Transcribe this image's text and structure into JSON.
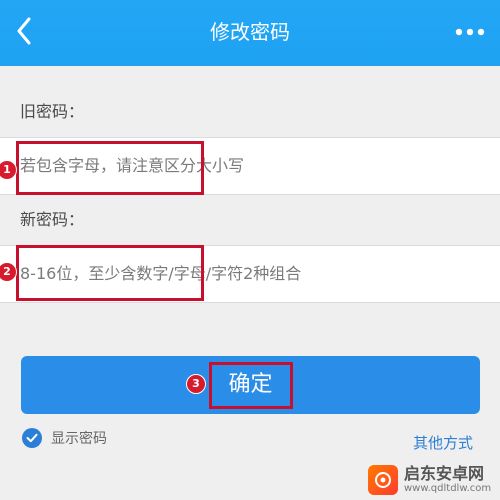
{
  "header": {
    "title": "修改密码",
    "back_icon": "chevron-left-icon",
    "more_icon": "more-dots-icon",
    "color": "#1ea1f2"
  },
  "old_password": {
    "label": "旧密码：",
    "placeholder": "若包含字母，请注意区分大小写"
  },
  "new_password": {
    "label": "新密码：",
    "placeholder": "8-16位，至少含数字/字母/字符2种组合"
  },
  "confirm_button": {
    "label": "确定",
    "color": "#2a8de8"
  },
  "show_password": {
    "label": "显示密码",
    "checked": true
  },
  "other_methods": {
    "label": "其他方式"
  },
  "annotations": {
    "step1": "1",
    "step2": "2",
    "step3": "3",
    "color": "#c8102e"
  },
  "watermark": {
    "name": "启东安卓网",
    "url": "www.qdltdlw.com"
  }
}
